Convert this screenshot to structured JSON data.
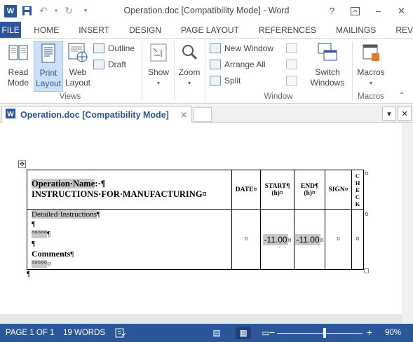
{
  "title_bar": {
    "title": "Operation.doc [Compatibility Mode] - Word",
    "app_icon": "word-logo",
    "help": "?",
    "minimize": "–",
    "close": "✕"
  },
  "ribbon_tabs": [
    "FILE",
    "HOME",
    "INSERT",
    "DESIGN",
    "PAGE LAYOUT",
    "REFERENCES",
    "MAILINGS",
    "REV"
  ],
  "ribbon": {
    "views": {
      "read_mode": "Read\nMode",
      "print_layout": "Print\nLayout",
      "web_layout": "Web\nLayout",
      "outline": "Outline",
      "draft": "Draft",
      "label": "Views"
    },
    "show": "Show",
    "zoom": "Zoom",
    "window": {
      "new_window": "New Window",
      "arrange_all": "Arrange All",
      "split": "Split",
      "switch_windows": "Switch\nWindows",
      "label": "Window"
    },
    "macros": {
      "macros": "Macros",
      "label": "Macros"
    }
  },
  "doc_tab": {
    "name": "Operation.doc [Compatibility Mode]",
    "close": "✕"
  },
  "document": {
    "header": {
      "operation_name": "Operation·Name",
      "operation_suffix": ":·¶",
      "instructions": "INSTRUCTIONS·FOR·MANUFACTURING¤",
      "date": "DATE¤",
      "start_a": "START¶",
      "start_b": "(h)¤",
      "end_a": "END¶",
      "end_b": "(h)¤",
      "sign": "SIGN¤",
      "check_letters": [
        "C",
        "H",
        "E",
        "C",
        "K"
      ],
      "check_end": "¤",
      "row_end": "¤"
    },
    "body": {
      "detailed": "Detailed·Instructions",
      "detailed_mark": "¶",
      "pilcrow1": "¶",
      "placeholder1": "°°°°°",
      "placeholder1_mark": "¶",
      "pilcrow2": "¶",
      "comments": "Comments",
      "comments_mark": "¶",
      "placeholder2": "°°°°°",
      "placeholder2_mark": "¤",
      "date_mark": "¤",
      "start_value": "-11.00",
      "start_mark": "¤",
      "end_value": "-11.00",
      "end_mark": "¤",
      "sign_mark": "¤",
      "check_mark": "¤",
      "row_end": "¤"
    },
    "after_table": "¶"
  },
  "status_bar": {
    "page": "PAGE 1 OF 1",
    "words": "19 WORDS",
    "zoom_out": "−",
    "zoom_in": "+",
    "zoom_level": "90%",
    "zoom_fraction": 0.56
  },
  "colors": {
    "accent": "#2b579a",
    "status_bar": "#2b579a",
    "highlight": "#c8c8c8"
  }
}
